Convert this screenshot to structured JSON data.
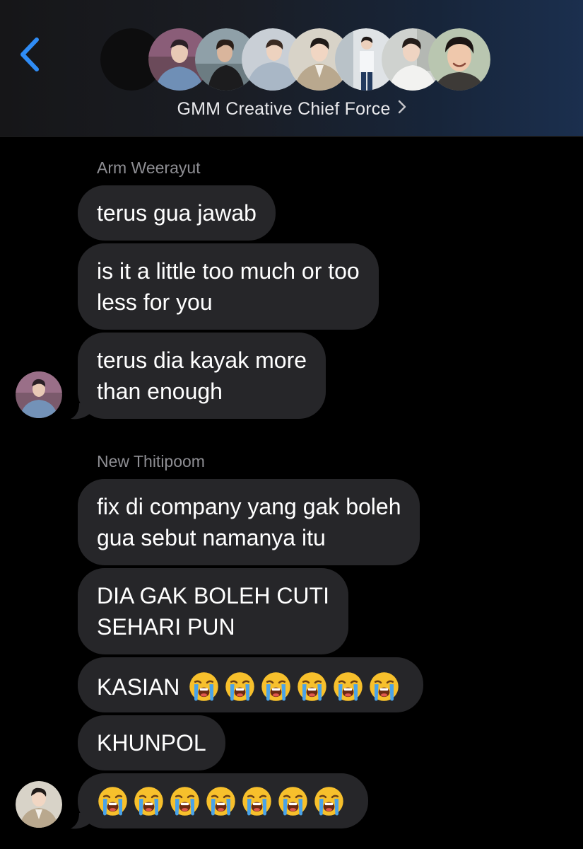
{
  "header": {
    "back_icon": "chevron-left-icon",
    "group_name": "GMM Creative Chief Force",
    "title_chevron_icon": "chevron-right-icon",
    "accent_color": "#2f8cf5",
    "participant_count_shown": 8
  },
  "thread": {
    "groups": [
      {
        "sender": "Arm Weerayut",
        "messages": [
          "terus gua jawab",
          "is it a little too much or too\nless for you",
          "terus dia kayak more\nthan enough"
        ]
      },
      {
        "sender": "New Thitipoom",
        "messages": [
          "fix di company yang gak boleh\ngua sebut namanya itu",
          "DIA GAK BOLEH CUTI\nSEHARI PUN",
          "KASIAN",
          "KHUNPOL",
          ""
        ],
        "emoji": {
          "icon": "loudly-crying-face-icon",
          "kasian_count": 6,
          "last_count": 7
        }
      }
    ]
  },
  "colors": {
    "bubble": "#262629",
    "sender_name": "#8e8e93",
    "text": "#ffffff",
    "background": "#000000"
  }
}
